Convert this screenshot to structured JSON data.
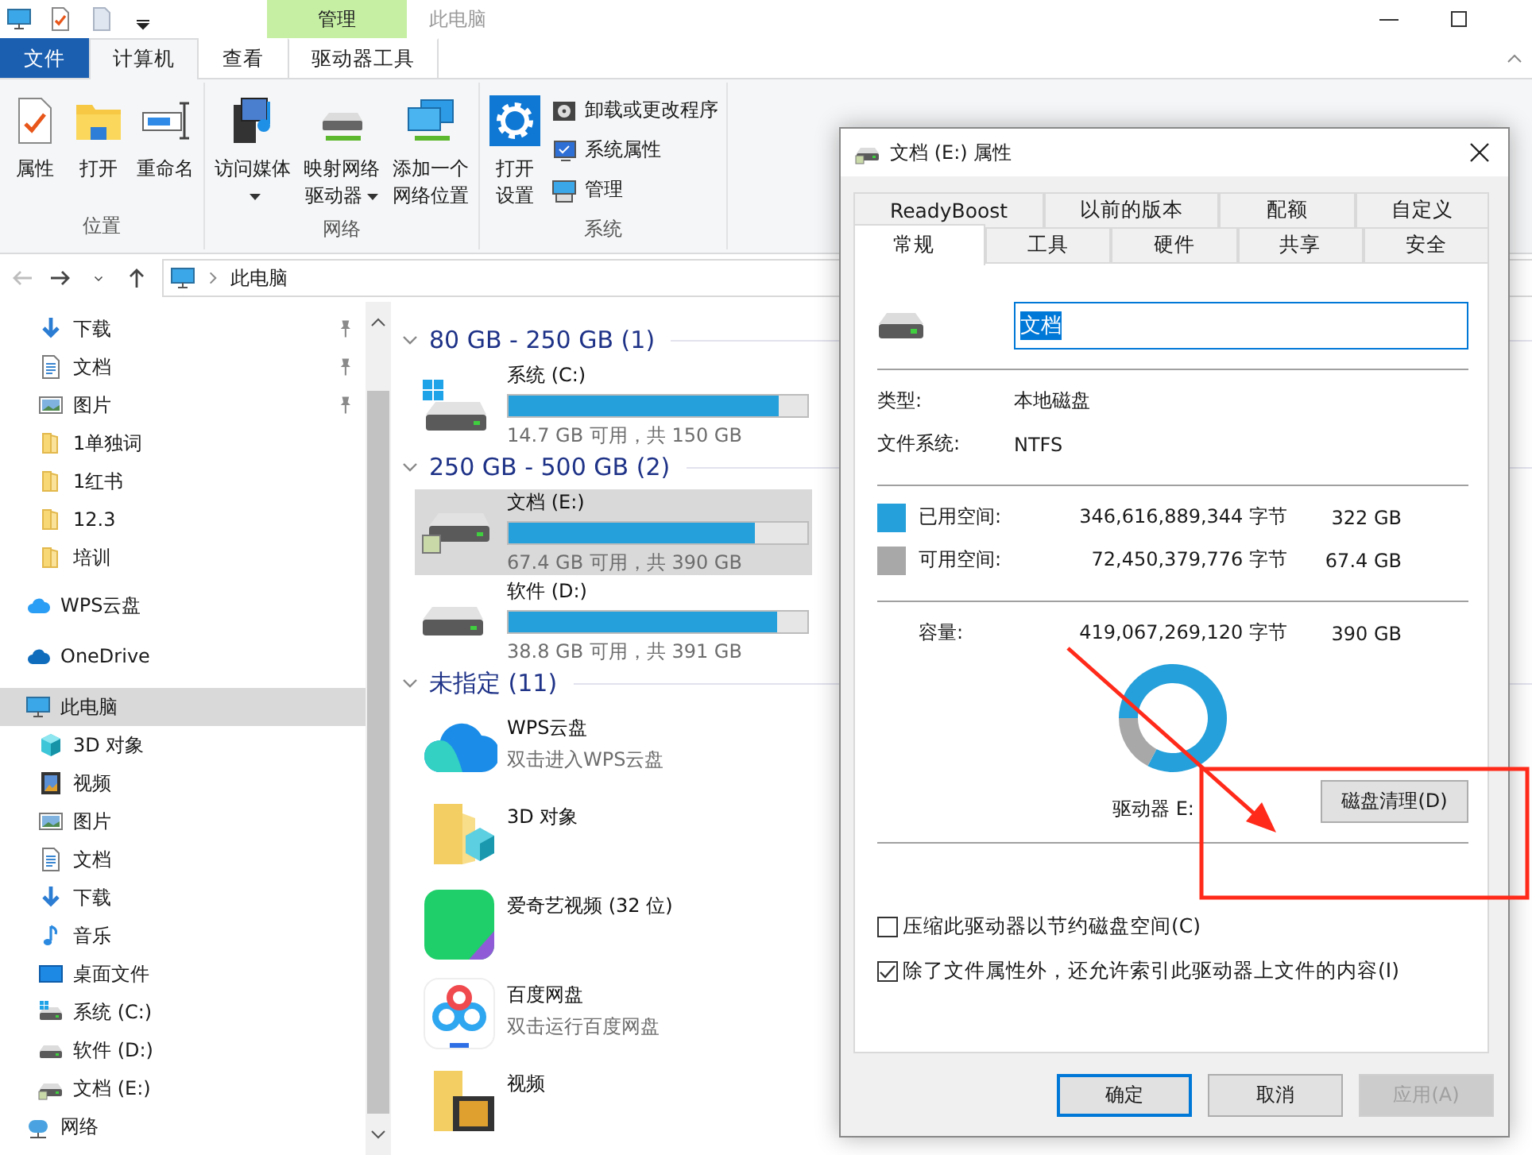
{
  "window": {
    "title": "此电脑",
    "contextual_group": "管理"
  },
  "quick_access_toolbar": [
    {
      "kind": "pc"
    },
    {
      "kind": "properties"
    },
    {
      "kind": "blank"
    },
    {
      "kind": "dropdown"
    }
  ],
  "ribbon_tabs": [
    {
      "label": "文件",
      "kind": "file",
      "selected": false
    },
    {
      "label": "计算机",
      "kind": "normal",
      "selected": true
    },
    {
      "label": "查看",
      "kind": "normal",
      "selected": false
    },
    {
      "label": "驱动器工具",
      "kind": "contextual",
      "selected": false
    }
  ],
  "ribbon_groups": [
    {
      "label": "位置",
      "commands": [
        {
          "label": "属性",
          "dropdown": false
        },
        {
          "label": "打开",
          "dropdown": false
        },
        {
          "label": "重命名",
          "dropdown": false
        }
      ]
    },
    {
      "label": "网络",
      "commands": [
        {
          "label": "访问媒体",
          "dropdown": true
        },
        {
          "label": "映射网络驱动器",
          "dropdown": true
        },
        {
          "label": "添加一个网络位置",
          "dropdown": false
        }
      ]
    },
    {
      "label": "系统",
      "commands": [
        {
          "label": "打开设置",
          "dropdown": false
        }
      ],
      "small_commands": [
        {
          "label": "卸载或更改程序"
        },
        {
          "label": "系统属性"
        },
        {
          "label": "管理"
        }
      ]
    }
  ],
  "navigation_buttons": [
    {
      "kind": "back",
      "disabled": true
    },
    {
      "kind": "forward",
      "disabled": false
    },
    {
      "kind": "recent",
      "disabled": false
    },
    {
      "kind": "up",
      "disabled": false
    }
  ],
  "address_bar": {
    "path": [
      "此电脑"
    ]
  },
  "navigation_pane": {
    "quick_access_items": [
      {
        "label": "下载",
        "kind": "download",
        "pinned": true,
        "selected": false
      },
      {
        "label": "文档",
        "kind": "document",
        "pinned": true,
        "selected": false
      },
      {
        "label": "图片",
        "kind": "picture",
        "pinned": true,
        "selected": false
      },
      {
        "label": "1单独词",
        "kind": "folder",
        "pinned": false,
        "selected": false
      },
      {
        "label": "1红书",
        "kind": "folder",
        "pinned": false,
        "selected": false
      },
      {
        "label": "12.3",
        "kind": "folder",
        "pinned": false,
        "selected": false
      },
      {
        "label": "培训",
        "kind": "folder",
        "pinned": false,
        "selected": false
      }
    ],
    "items": [
      {
        "label": "WPS云盘",
        "kind": "wps",
        "selected": false
      },
      {
        "label": "OneDrive",
        "kind": "onedrive",
        "selected": false
      },
      {
        "label": "此电脑",
        "kind": "pc",
        "selected": true,
        "children": [
          {
            "label": "3D 对象",
            "kind": "cube",
            "selected": false
          },
          {
            "label": "视频",
            "kind": "video",
            "selected": false
          },
          {
            "label": "图片",
            "kind": "picture",
            "selected": false
          },
          {
            "label": "文档",
            "kind": "document",
            "selected": false
          },
          {
            "label": "下载",
            "kind": "download",
            "selected": false
          },
          {
            "label": "音乐",
            "kind": "music",
            "selected": false
          },
          {
            "label": "桌面文件",
            "kind": "desktop",
            "selected": false
          },
          {
            "label": "系统 (C:)",
            "kind": "drive-system",
            "selected": false
          },
          {
            "label": "软件 (D:)",
            "kind": "drive",
            "selected": false
          },
          {
            "label": "文档 (E:)",
            "kind": "drive-shared",
            "selected": false
          }
        ]
      },
      {
        "label": "网络",
        "kind": "network",
        "selected": false
      }
    ]
  },
  "content": {
    "groups": [
      {
        "label": "80 GB - 250 GB (1)",
        "expanded": true,
        "items": [
          {
            "kind": "drive-system",
            "name": "系统 (C:)",
            "level": 0.902,
            "detail": "14.7 GB 可用，共 150 GB",
            "selected": false
          }
        ]
      },
      {
        "label": "250 GB - 500 GB (2)",
        "expanded": true,
        "items": [
          {
            "kind": "drive-shared",
            "name": "文档 (E:)",
            "level": 0.827,
            "detail": "67.4 GB 可用，共 390 GB",
            "selected": true
          },
          {
            "kind": "drive",
            "name": "软件 (D:)",
            "level": 0.901,
            "detail": "38.8 GB 可用，共 391 GB",
            "selected": false
          }
        ]
      },
      {
        "label": "未指定 (11)",
        "expanded": true,
        "items": [
          {
            "kind": "cloud",
            "name": "WPS云盘",
            "detail": "双击进入WPS云盘",
            "selected": false
          },
          {
            "kind": "folder-3d",
            "name": "3D 对象",
            "selected": false
          },
          {
            "kind": "app-green",
            "name": "爱奇艺视频 (32 位)",
            "selected": false
          },
          {
            "kind": "app-rings",
            "name": "百度网盘",
            "detail": "双击运行百度网盘",
            "selected": false
          },
          {
            "kind": "folder-video",
            "name": "视频",
            "selected": false
          }
        ]
      }
    ]
  },
  "dialog": {
    "title": "文档 (E:) 属性",
    "tab_rows": [
      [
        {
          "label": "ReadyBoost",
          "selected": false
        },
        {
          "label": "以前的版本",
          "selected": false
        },
        {
          "label": "配额",
          "selected": false
        },
        {
          "label": "自定义",
          "selected": false
        }
      ],
      [
        {
          "label": "常规",
          "selected": true
        },
        {
          "label": "工具",
          "selected": false
        },
        {
          "label": "硬件",
          "selected": false
        },
        {
          "label": "共享",
          "selected": false
        },
        {
          "label": "安全",
          "selected": false
        }
      ]
    ],
    "name_field": {
      "value": "文档",
      "text_selected": true
    },
    "info": [
      {
        "label": "类型:",
        "value": "本地磁盘"
      },
      {
        "label": "文件系统:",
        "value": "NTFS"
      }
    ],
    "space": [
      {
        "label": "已用空间:",
        "bytes": "346,616,889,344 字节",
        "size": "322 GB",
        "color": "#26a0da"
      },
      {
        "label": "可用空间:",
        "bytes": "72,450,379,776 字节",
        "size": "67.4 GB",
        "color": "#a8a8a8"
      }
    ],
    "capacity": {
      "label": "容量:",
      "bytes": "419,067,269,120 字节",
      "size": "390 GB"
    },
    "chart_data": {
      "type": "donut",
      "values": [
        82.7,
        17.3
      ]
    },
    "drive_label": "驱动器 E:",
    "cleanup_button": "磁盘清理(D)",
    "options": [
      {
        "label": "压缩此驱动器以节约磁盘空间(C)",
        "checked": false
      },
      {
        "label": "除了文件属性外，还允许索引此驱动器上文件的内容(I)",
        "checked": true
      }
    ],
    "buttons": [
      {
        "label": "确定",
        "kind": "default",
        "disabled": false
      },
      {
        "label": "取消",
        "kind": "normal",
        "disabled": false
      },
      {
        "label": "应用(A)",
        "kind": "normal",
        "disabled": true
      }
    ]
  }
}
